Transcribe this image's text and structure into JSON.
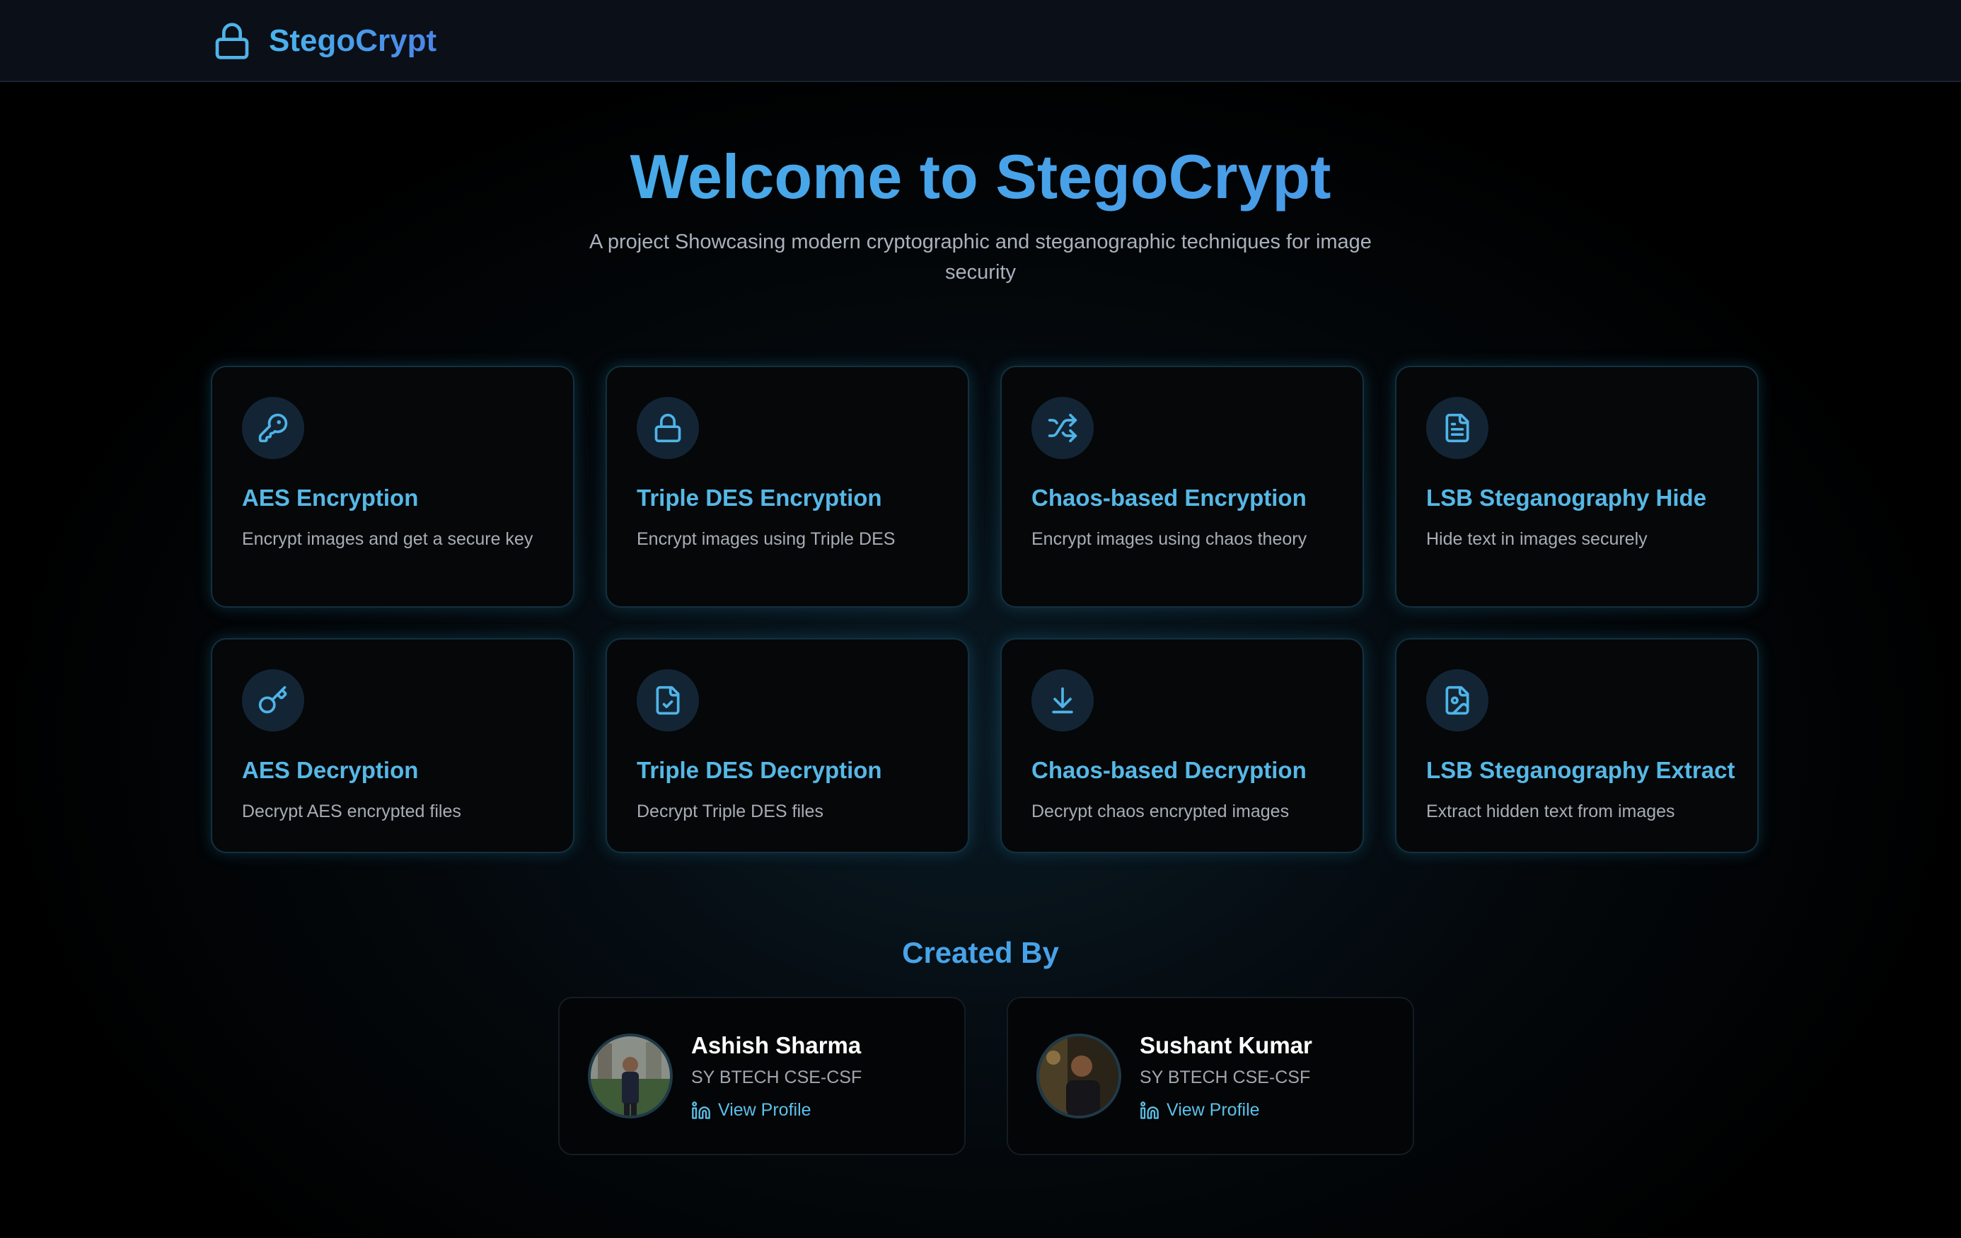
{
  "app": {
    "name": "StegoCrypt"
  },
  "hero": {
    "title": "Welcome to StegoCrypt",
    "subtitle": "A project Showcasing modern cryptographic and steganographic techniques for image security"
  },
  "cards": [
    {
      "icon": "key-icon",
      "title": "AES Encryption",
      "desc": "Encrypt images and get a secure key"
    },
    {
      "icon": "lock-icon",
      "title": "Triple DES Encryption",
      "desc": "Encrypt images using Triple DES"
    },
    {
      "icon": "shuffle-icon",
      "title": "Chaos-based Encryption",
      "desc": "Encrypt images using chaos theory"
    },
    {
      "icon": "file-text-icon",
      "title": "LSB Steganography Hide",
      "desc": "Hide text in images securely"
    },
    {
      "icon": "key-round-icon",
      "title": "AES Decryption",
      "desc": "Decrypt AES encrypted files"
    },
    {
      "icon": "file-check-icon",
      "title": "Triple DES Decryption",
      "desc": "Decrypt Triple DES files"
    },
    {
      "icon": "download-icon",
      "title": "Chaos-based Decryption",
      "desc": "Decrypt chaos encrypted images"
    },
    {
      "icon": "file-image-icon",
      "title": "LSB Steganography Extract",
      "desc": "Extract hidden text from images"
    }
  ],
  "created_by": {
    "heading": "Created By",
    "people": [
      {
        "name": "Ashish Sharma",
        "role": "SY BTECH CSE-CSF",
        "link": "View Profile",
        "link_icon": "linkedin-icon"
      },
      {
        "name": "Sushant Kumar",
        "role": "SY BTECH CSE-CSF",
        "link": "View Profile",
        "link_icon": "linkedin-icon"
      }
    ]
  },
  "colors": {
    "accent": "#4fb4e8",
    "background": "#000000",
    "card_border": "#13303e"
  }
}
